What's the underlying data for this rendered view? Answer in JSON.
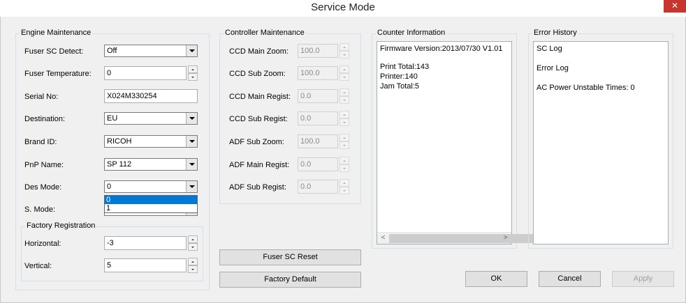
{
  "window": {
    "title": "Service Mode",
    "close_glyph": "✕"
  },
  "engine": {
    "group_title": "Engine Maintenance",
    "fuser_sc_detect": {
      "label": "Fuser SC Detect:",
      "value": "Off"
    },
    "fuser_temperature": {
      "label": "Fuser Temperature:",
      "value": "0"
    },
    "serial_no": {
      "label": "Serial No:",
      "value": "X024M330254"
    },
    "destination": {
      "label": "Destination:",
      "value": "EU"
    },
    "brand_id": {
      "label": "Brand ID:",
      "value": "RICOH"
    },
    "pnp_name": {
      "label": "PnP Name:",
      "value": "SP 112"
    },
    "des_mode": {
      "label": "Des Mode:",
      "value": "0",
      "options": [
        "0",
        "1"
      ],
      "highlighted": "0"
    },
    "s_mode": {
      "label": "S. Mode:"
    },
    "factory_registration": {
      "group_title": "Factory Registration",
      "horizontal": {
        "label": "Horizontal:",
        "value": "-3"
      },
      "vertical": {
        "label": "Vertical:",
        "value": "5"
      }
    }
  },
  "controller": {
    "group_title": "Controller Maintenance",
    "ccd_main_zoom": {
      "label": "CCD Main Zoom:",
      "value": "100.0"
    },
    "ccd_sub_zoom": {
      "label": "CCD Sub Zoom:",
      "value": "100.0"
    },
    "ccd_main_regist": {
      "label": "CCD Main Regist:",
      "value": "0.0"
    },
    "ccd_sub_regist": {
      "label": "CCD Sub Regist:",
      "value": "0.0"
    },
    "adf_sub_zoom": {
      "label": "ADF Sub Zoom:",
      "value": "100.0"
    },
    "adf_main_regist": {
      "label": "ADF Main Regist:",
      "value": "0.0"
    },
    "adf_sub_regist": {
      "label": "ADF Sub Regist:",
      "value": "0.0"
    }
  },
  "counter": {
    "group_title": "Counter Information",
    "lines": [
      "Firmware Version:2013/07/30 V1.01",
      "",
      "Print Total:143",
      "Printer:140",
      "Jam Total:5"
    ]
  },
  "error_history": {
    "group_title": "Error History",
    "lines": [
      "SC Log",
      "",
      "Error Log",
      "",
      "AC Power Unstable Times: 0"
    ]
  },
  "buttons": {
    "fuser_sc_reset": "Fuser SC Reset",
    "factory_default": "Factory Default",
    "ok": "OK",
    "cancel": "Cancel",
    "apply": "Apply"
  },
  "scrollbar": {
    "left_glyph": "<",
    "right_glyph": ">"
  }
}
